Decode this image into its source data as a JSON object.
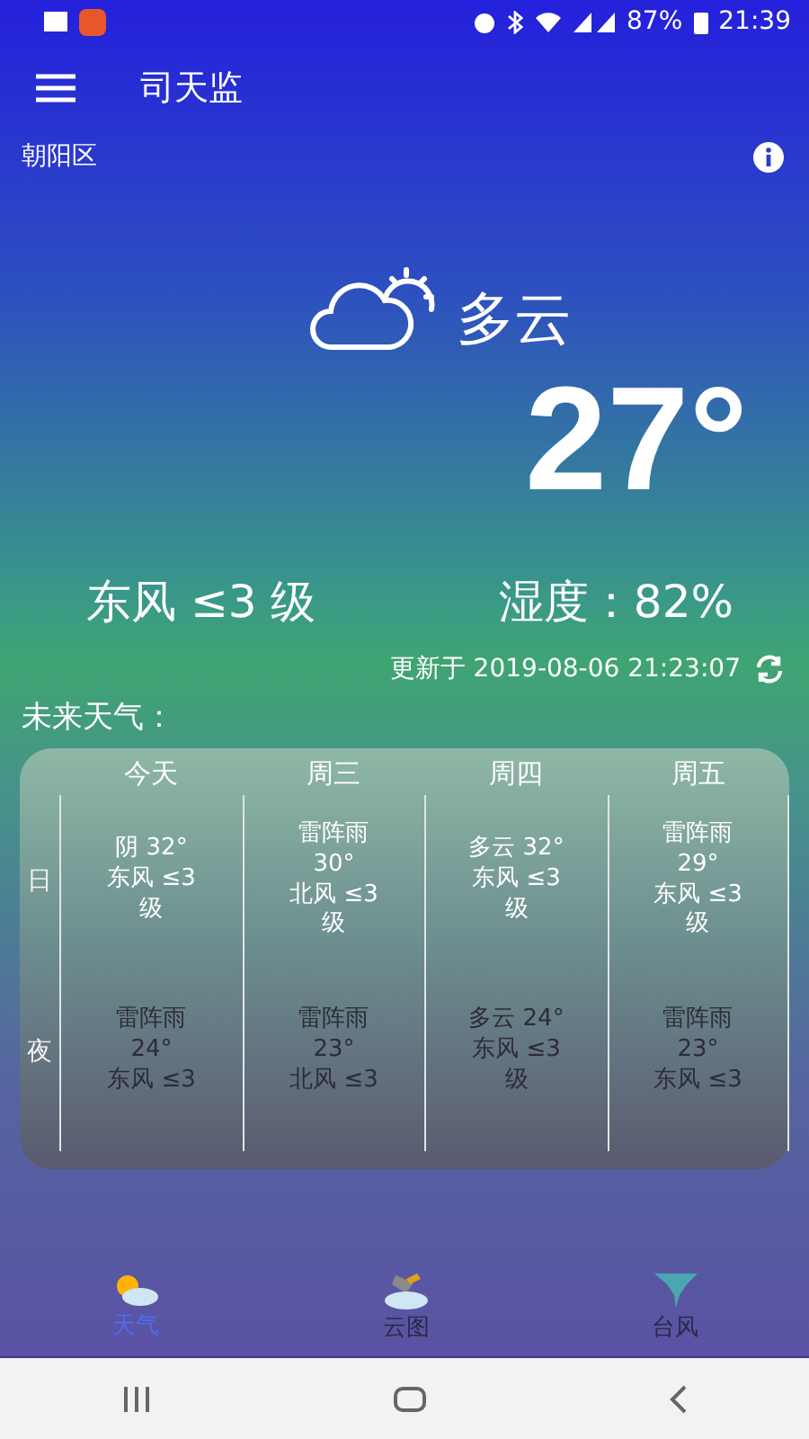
{
  "status_bar": {
    "battery": "87%",
    "time": "21:39"
  },
  "app_bar": {
    "title": "司天监"
  },
  "location": "朝阳区",
  "current": {
    "condition": "多云",
    "temperature": "27°",
    "wind": "东风 ≤3 级",
    "humidity": "湿度：82%",
    "updated": "更新于 2019-08-06 21:23:07"
  },
  "forecast": {
    "label": "未来天气：",
    "columns": [
      "今天",
      "周三",
      "周四",
      "周五"
    ],
    "rows": [
      {
        "label": "日",
        "cells": [
          "阴 32°\n东风 ≤3\n级",
          "雷阵雨\n30°\n北风 ≤3\n级",
          "多云 32°\n东风 ≤3\n级",
          "雷阵雨\n29°\n东风 ≤3\n级"
        ]
      },
      {
        "label": "夜",
        "cells": [
          "雷阵雨\n24°\n东风 ≤3",
          "雷阵雨\n23°\n北风 ≤3",
          "多云 24°\n东风 ≤3\n级",
          "雷阵雨\n23°\n东风 ≤3"
        ]
      }
    ]
  },
  "bottom_nav": [
    {
      "label": "天气",
      "kind": "weather",
      "selected": true
    },
    {
      "label": "云图",
      "kind": "cloud",
      "selected": false
    },
    {
      "label": "台风",
      "kind": "typhoon",
      "selected": false
    }
  ]
}
